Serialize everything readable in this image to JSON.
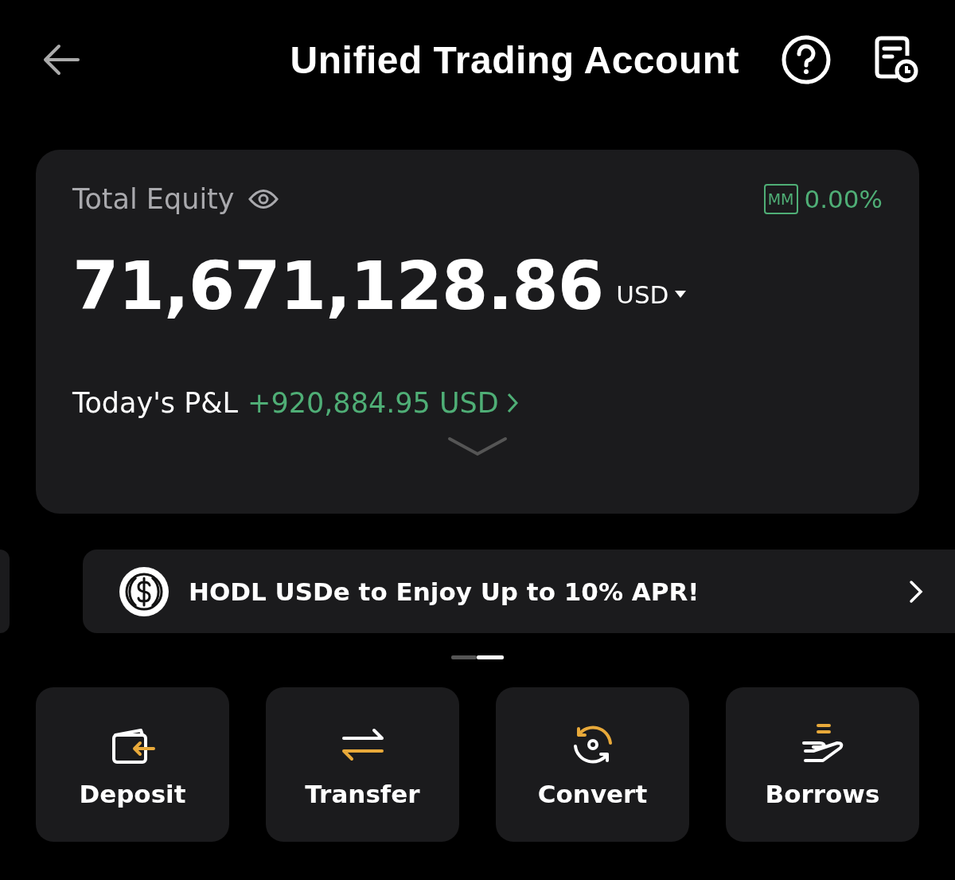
{
  "header": {
    "title": "Unified Trading Account"
  },
  "equity": {
    "label": "Total Equity",
    "mm_badge": "MM",
    "mm_value": "0.00%",
    "amount": "71,671,128.86",
    "currency": "USD",
    "pnl_label": "Today's P&L",
    "pnl_value": "+920,884.95 USD"
  },
  "banner": {
    "text": "HODL USDe to Enjoy Up to 10% APR!"
  },
  "carousel": [
    {
      "selected": false
    },
    {
      "selected": true
    }
  ],
  "actions": [
    {
      "kind": "deposit",
      "label": "Deposit"
    },
    {
      "kind": "transfer",
      "label": "Transfer"
    },
    {
      "kind": "convert",
      "label": "Convert"
    },
    {
      "kind": "borrow",
      "label": "Borrows"
    }
  ]
}
